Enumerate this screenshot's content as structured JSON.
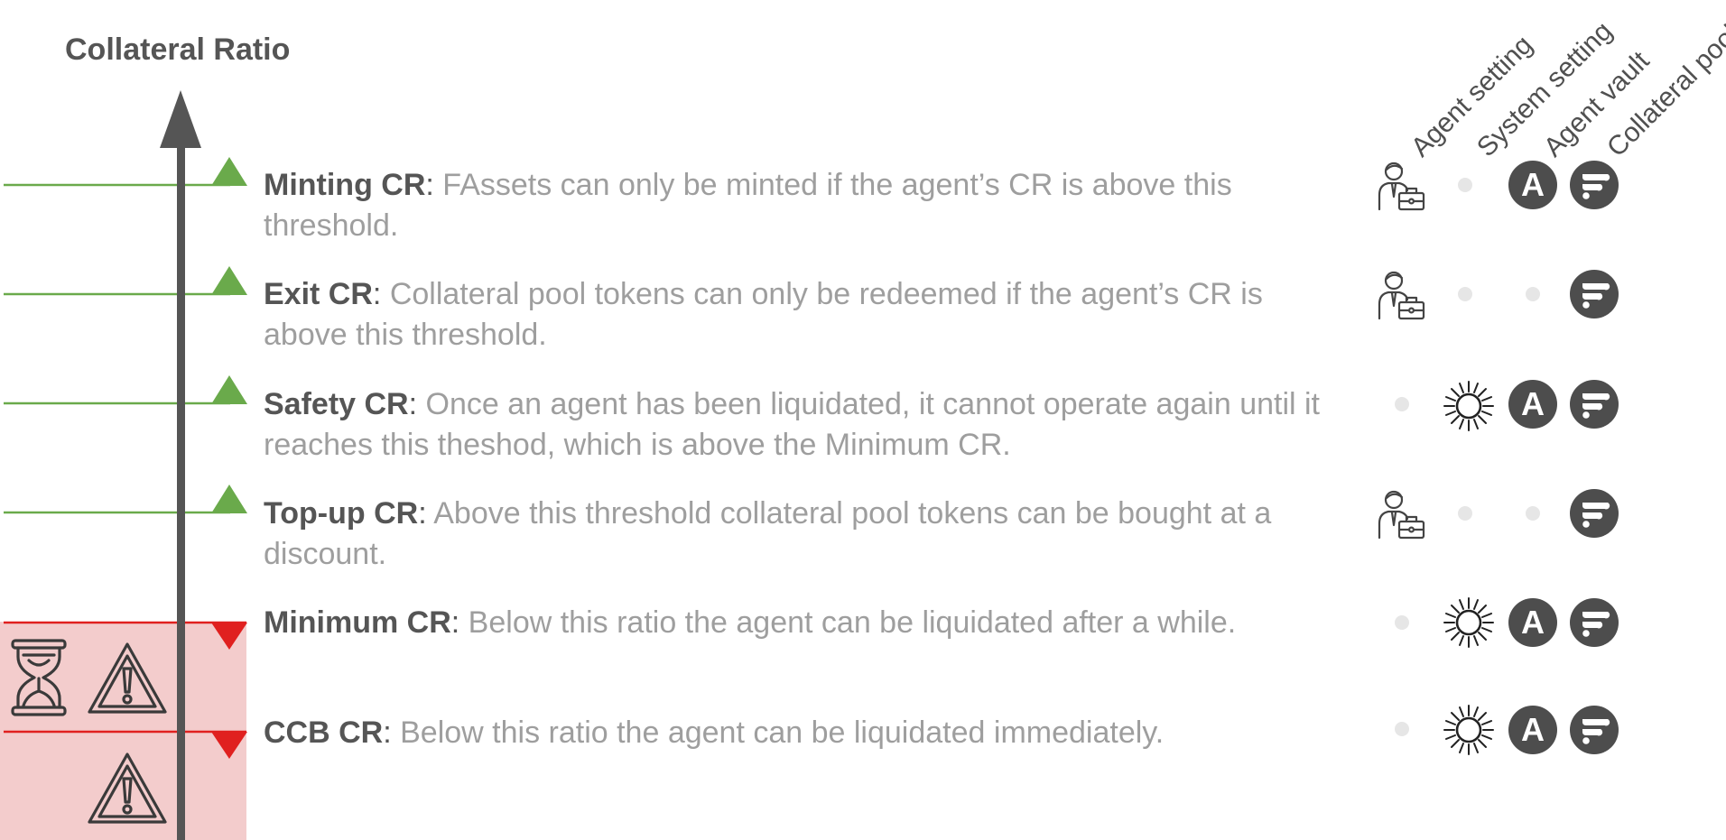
{
  "axis": {
    "title": "Collateral Ratio"
  },
  "columns": [
    "Agent setting",
    "System setting",
    "Agent vault",
    "Collateral pool"
  ],
  "vault_badge_letter": "A",
  "colors": {
    "above": "#6aaa4b",
    "below": "#e0201f",
    "danger_zone": "#f3cccc",
    "axis": "#555555",
    "badge": "#4d4d4d"
  },
  "rows": [
    {
      "term": "Minting CR",
      "colon": ":",
      "desc": " FAssets can only be minted if the agent’s CR is above this threshold.",
      "direction": "above",
      "marks": [
        "agent-setting-icon",
        "dot",
        "agent-vault-badge",
        "collateral-pool-badge"
      ]
    },
    {
      "term": "Exit CR",
      "colon": ":",
      "desc": " Collateral pool tokens can only be redeemed if the agent’s CR is above this threshold.",
      "direction": "above",
      "marks": [
        "agent-setting-icon",
        "dot",
        "dot",
        "collateral-pool-badge"
      ]
    },
    {
      "term": "Safety CR",
      "colon": ":",
      "desc": " Once an agent has been liquidated, it cannot operate again until it reaches this theshod, which is above the Minimum CR.",
      "direction": "above",
      "marks": [
        "dot",
        "system-setting-icon",
        "agent-vault-badge",
        "collateral-pool-badge"
      ]
    },
    {
      "term": "Top-up CR",
      "colon": ":",
      "desc": " Above this threshold collateral pool tokens can be bought at a discount.",
      "direction": "above",
      "marks": [
        "agent-setting-icon",
        "dot",
        "dot",
        "collateral-pool-badge"
      ]
    },
    {
      "term": "Minimum CR",
      "colon": ":",
      "desc": " Below this ratio the agent can be liquidated after a while.",
      "direction": "below",
      "marks": [
        "dot",
        "system-setting-icon",
        "agent-vault-badge",
        "collateral-pool-badge"
      ]
    },
    {
      "term": "CCB CR",
      "colon": ":",
      "desc": " Below this ratio the agent can be liquidated immediately.",
      "direction": "below",
      "marks": [
        "dot",
        "system-setting-icon",
        "agent-vault-badge",
        "collateral-pool-badge"
      ]
    }
  ],
  "zone_icons": {
    "upper": [
      "hourglass-icon",
      "warning-icon"
    ],
    "lower": [
      "warning-icon"
    ]
  }
}
